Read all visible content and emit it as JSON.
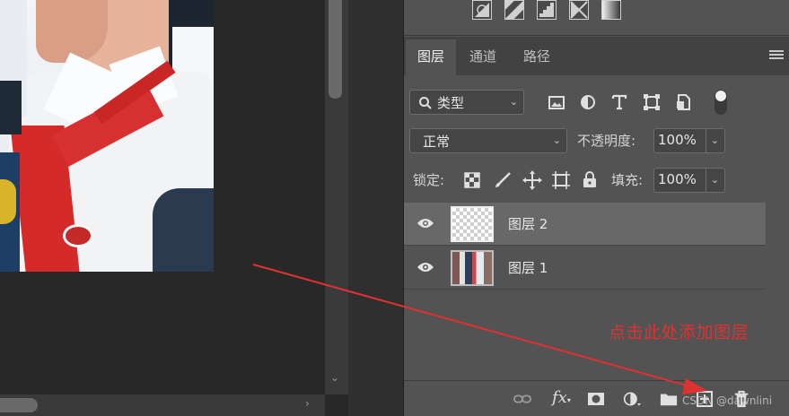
{
  "panel": {
    "tabs": [
      {
        "label": "图层",
        "active": true
      },
      {
        "label": "通道",
        "active": false
      },
      {
        "label": "路径",
        "active": false
      }
    ],
    "filter": {
      "label": "类型"
    },
    "blend_mode": {
      "value": "正常"
    },
    "opacity": {
      "label": "不透明度:",
      "value": "100%"
    },
    "lock": {
      "label": "锁定:"
    },
    "fill": {
      "label": "填充:",
      "value": "100%"
    },
    "layers": [
      {
        "name": "图层 2",
        "selected": true,
        "thumbnail": "transparent"
      },
      {
        "name": "图层 1",
        "selected": false,
        "thumbnail": "photo"
      }
    ]
  },
  "annotation": {
    "text": "点击此处添加图层",
    "color": "#e03131"
  },
  "watermark": "CSDN @dawnlini",
  "icons": {
    "top": [
      "brightness-contrast-icon",
      "gradient-map-icon",
      "posterize-icon",
      "threshold-icon",
      "gradient-fill-icon"
    ],
    "filter": [
      "search-icon",
      "image-filter-icon",
      "adjustment-filter-icon",
      "type-filter-icon",
      "shape-filter-icon",
      "smart-object-filter-icon",
      "filter-toggle-icon"
    ],
    "lock": [
      "lock-transparent-pixels-icon",
      "lock-image-pixels-icon",
      "lock-position-icon",
      "lock-artboard-icon",
      "lock-all-icon"
    ],
    "bottom": [
      "link-layers-icon",
      "fx-icon",
      "layer-mask-icon",
      "adjustment-layer-icon",
      "group-folder-icon",
      "new-layer-icon",
      "delete-icon"
    ]
  }
}
